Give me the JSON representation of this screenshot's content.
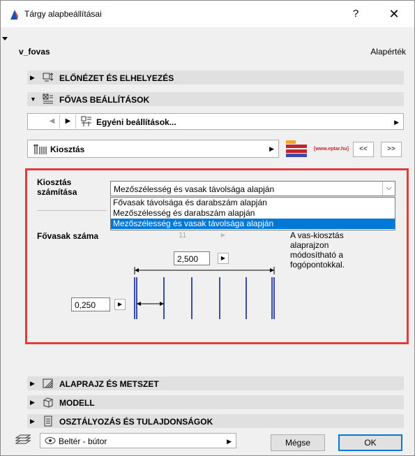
{
  "window": {
    "title": "Tárgy alapbeállításai",
    "help_label": "?",
    "close_label": "✕"
  },
  "object": {
    "name": "v_fovas",
    "defaults_label": "Alapérték"
  },
  "sections": {
    "preview": "ELŐNÉZET ÉS ELHELYEZÉS",
    "main_bar": "FŐVAS BEÁLLÍTÁSOK",
    "floorplan": "ALAPRAJZ ÉS METSZET",
    "model": "MODELL",
    "classification": "OSZTÁLYOZÁS ÉS TULAJDONSÁGOK"
  },
  "nav": {
    "prev_icon": "left-arrow",
    "next_icon": "right-arrow",
    "custom_label": "Egyéni beállítások...",
    "page_label": "Kiosztás",
    "logo_text": "[www.eptar.hu]",
    "prev_page": "<<",
    "next_page": ">>"
  },
  "panel": {
    "calc_label_1": "Kiosztás",
    "calc_label_2": "számítása",
    "calc_selected": "Mezőszélesség és vasak távolsága alapján",
    "calc_options": [
      "Fővasak távolsága és darabszám alapján",
      "Mezőszélesség és darabszám alapján",
      "Mezőszélesség és vasak távolsága alapján"
    ],
    "count_label": "Fővasak száma",
    "count_value": "11",
    "help_lines": [
      "A vas-kiosztás",
      "alaprajzon",
      "módosítható a",
      "fogópontokkal."
    ],
    "field_width": "2,500",
    "bar_spacing": "0,250",
    "bar_count_drawn": 6
  },
  "footer": {
    "layer_value": "Beltér - bútor",
    "cancel_label": "Mégse",
    "ok_label": "OK"
  },
  "colors": {
    "accent_red": "#e03c3c",
    "selection_blue": "#0078d7",
    "rebar_blue": "#3a4ca8"
  }
}
